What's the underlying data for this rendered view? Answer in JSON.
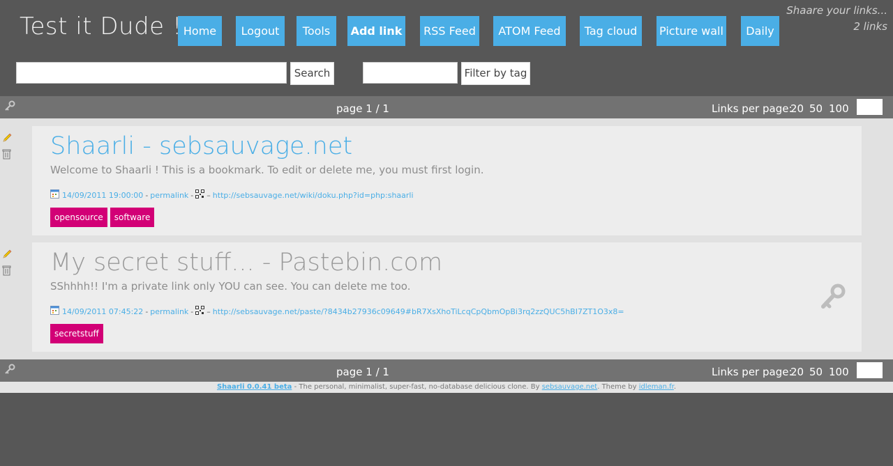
{
  "header": {
    "title": "Test it Dude !",
    "tagline": "Shaare your links...",
    "link_count": "2 links",
    "nav": [
      {
        "label": "Home",
        "bold": false
      },
      {
        "label": "Logout",
        "bold": false
      },
      {
        "label": "Tools",
        "bold": false
      },
      {
        "label": "Add link",
        "bold": true
      },
      {
        "label": "RSS Feed",
        "bold": false
      },
      {
        "label": "ATOM Feed",
        "bold": false
      },
      {
        "label": "Tag cloud",
        "bold": false
      },
      {
        "label": "Picture wall",
        "bold": false
      },
      {
        "label": "Daily",
        "bold": false
      }
    ]
  },
  "search": {
    "term_value": "",
    "search_label": "Search",
    "tag_value": "",
    "filter_label": "Filter by tag"
  },
  "paging": {
    "page": "page 1 / 1",
    "links_per_page_label": "Links per page:",
    "options": [
      "20",
      "50",
      "100"
    ],
    "custom_value": ""
  },
  "links": [
    {
      "title": "Shaarli - sebsauvage.net",
      "description": "Welcome to Shaarli ! This is a bookmark. To edit or delete me, you must first login.",
      "date": "14/09/2011 19:00:00",
      "permalink": "permalink",
      "url": "http://sebsauvage.net/wiki/doku.php?id=php:shaarli",
      "tags": [
        "opensource",
        "software"
      ],
      "private": false
    },
    {
      "title": "My secret stuff... - Pastebin.com",
      "description": "SShhhh!!  I'm a private link only YOU can see. You can delete me too.",
      "date": "14/09/2011 07:45:22",
      "permalink": "permalink",
      "url": "http://sebsauvage.net/paste/?8434b27936c09649#bR7XsXhoTiLcqCpQbmOpBi3rq2zzQUC5hBI7ZT1O3x8=",
      "tags": [
        "secretstuff"
      ],
      "private": true
    }
  ],
  "footer": {
    "brand": "Shaarli 0.0.41 beta",
    "text": " - The personal, minimalist, super-fast, no-database delicious clone. By ",
    "author": "sebsauvage.net",
    "theme_text": ". Theme by ",
    "theme_author": "idleman.fr",
    "end": "."
  },
  "colors": {
    "background": "#575757",
    "accent": "#4aaee6",
    "tag": "#d20076",
    "private_title": "#999999"
  },
  "icons": {
    "edit": "pencil-icon",
    "delete": "trash-icon",
    "date": "calendar-icon",
    "qrcode": "qrcode-icon",
    "private": "key-icon"
  }
}
